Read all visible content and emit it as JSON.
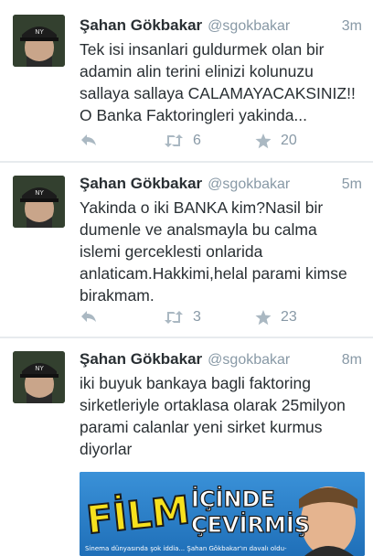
{
  "tweets": [
    {
      "name": "Şahan Gökbakar",
      "handle": "@sgokbakar",
      "time": "3m",
      "lines": [
        "Tek isi insanlari guldurmek olan bir",
        "adamin alin terini elinizi kolunuzu",
        "sallaya sallaya CALAMAYACAKSINIZ!!",
        "O Banka Faktoringleri yakinda..."
      ],
      "retweets": "6",
      "favorites": "20"
    },
    {
      "name": "Şahan Gökbakar",
      "handle": "@sgokbakar",
      "time": "5m",
      "lines": [
        "Yakinda o iki BANKA kim?Nasil bir",
        "dumenle ve analsmayla bu calma",
        "islemi gerceklesti onlarida",
        "anlaticam.Hakkimi,helal parami kimse",
        "birakmam."
      ],
      "retweets": "3",
      "favorites": "23"
    },
    {
      "name": "Şahan Gökbakar",
      "handle": "@sgokbakar",
      "time": "8m",
      "lines": [
        "iki buyuk bankaya bagli faktoring",
        "sirketleriyle ortaklasa olarak 25milyon",
        "parami calanlar yeni sirket kurmus",
        "diyorlar"
      ],
      "media": {
        "headline_film": "FİLM",
        "headline_icinde": "İÇİNDE",
        "headline_cevirmis": "ÇEVİRMİŞ",
        "caption": "Sinema dünyasında şok iddia... Şahan Gökbakar'ın davalı oldu-"
      }
    }
  ],
  "colors": {
    "text": "#292f33",
    "muted": "#8899a6",
    "media_bg": "#2b7fc9",
    "headline_yellow": "#f7e11d"
  }
}
